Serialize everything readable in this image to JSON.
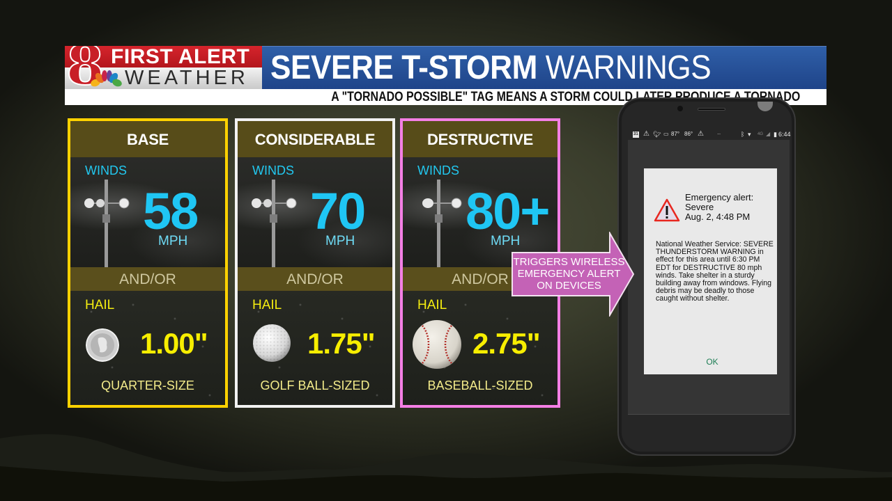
{
  "brand": {
    "logo_number": "8",
    "logo_line1": "FIRST ALERT",
    "logo_line2": "WEATHER"
  },
  "header": {
    "title_bold": "SEVERE T-STORM",
    "title_light": "WARNINGS",
    "subtitle": "A \"TORNADO POSSIBLE\" TAG MEANS A STORM COULD LATER PRODUCE A TORNADO"
  },
  "cards": [
    {
      "tier": "BASE",
      "border_color": "#ffd200",
      "winds_label": "WINDS",
      "wind_value": "58",
      "wind_unit": "MPH",
      "connector": "AND/OR",
      "hail_label": "HAIL",
      "hail_icon": "quarter-coin-icon",
      "hail_value": "1.00\"",
      "hail_size": "QUARTER-SIZE"
    },
    {
      "tier": "CONSIDERABLE",
      "border_color": "#f2f2f2",
      "winds_label": "WINDS",
      "wind_value": "70",
      "wind_unit": "MPH",
      "connector": "AND/OR",
      "hail_label": "HAIL",
      "hail_icon": "golf-ball-icon",
      "hail_value": "1.75\"",
      "hail_size": "GOLF BALL-SIZED"
    },
    {
      "tier": "DESTRUCTIVE",
      "border_color": "#f47fe5",
      "winds_label": "WINDS",
      "wind_value": "80+",
      "wind_unit": "MPH",
      "connector": "AND/OR",
      "hail_label": "HAIL",
      "hail_icon": "baseball-icon",
      "hail_value": "2.75\"",
      "hail_size": "BASEBALL-SIZED"
    }
  ],
  "arrow": {
    "text_line1": "TRIGGERS WIRELESS",
    "text_line2": "EMERGENCY ALERT",
    "text_line3": "ON DEVICES",
    "color": "#c462b6"
  },
  "phone": {
    "statusbar": {
      "calendar_day": "31",
      "temp1": "87°",
      "temp2": "86°",
      "network": "4G",
      "time": "6:44"
    },
    "alert": {
      "title_line1": "Emergency alert:",
      "title_line2": "Severe",
      "title_line3": "Aug. 2, 4:48 PM",
      "body": "National Weather Service: SEVERE THUNDERSTORM WARNING in effect for this area until 6:30 PM EDT for DESTRUCTIVE 80 mph winds.  Take shelter in a sturdy building away from windows.  Flying debris may be deadly to those caught without shelter.",
      "ok_label": "OK"
    }
  },
  "colors": {
    "header_blue": "#2a56a0",
    "logo_red": "#c81f27",
    "wind_cyan": "#1fc6f4",
    "hail_yellow": "#f7ee00",
    "card_header_olive": "#574c19"
  }
}
